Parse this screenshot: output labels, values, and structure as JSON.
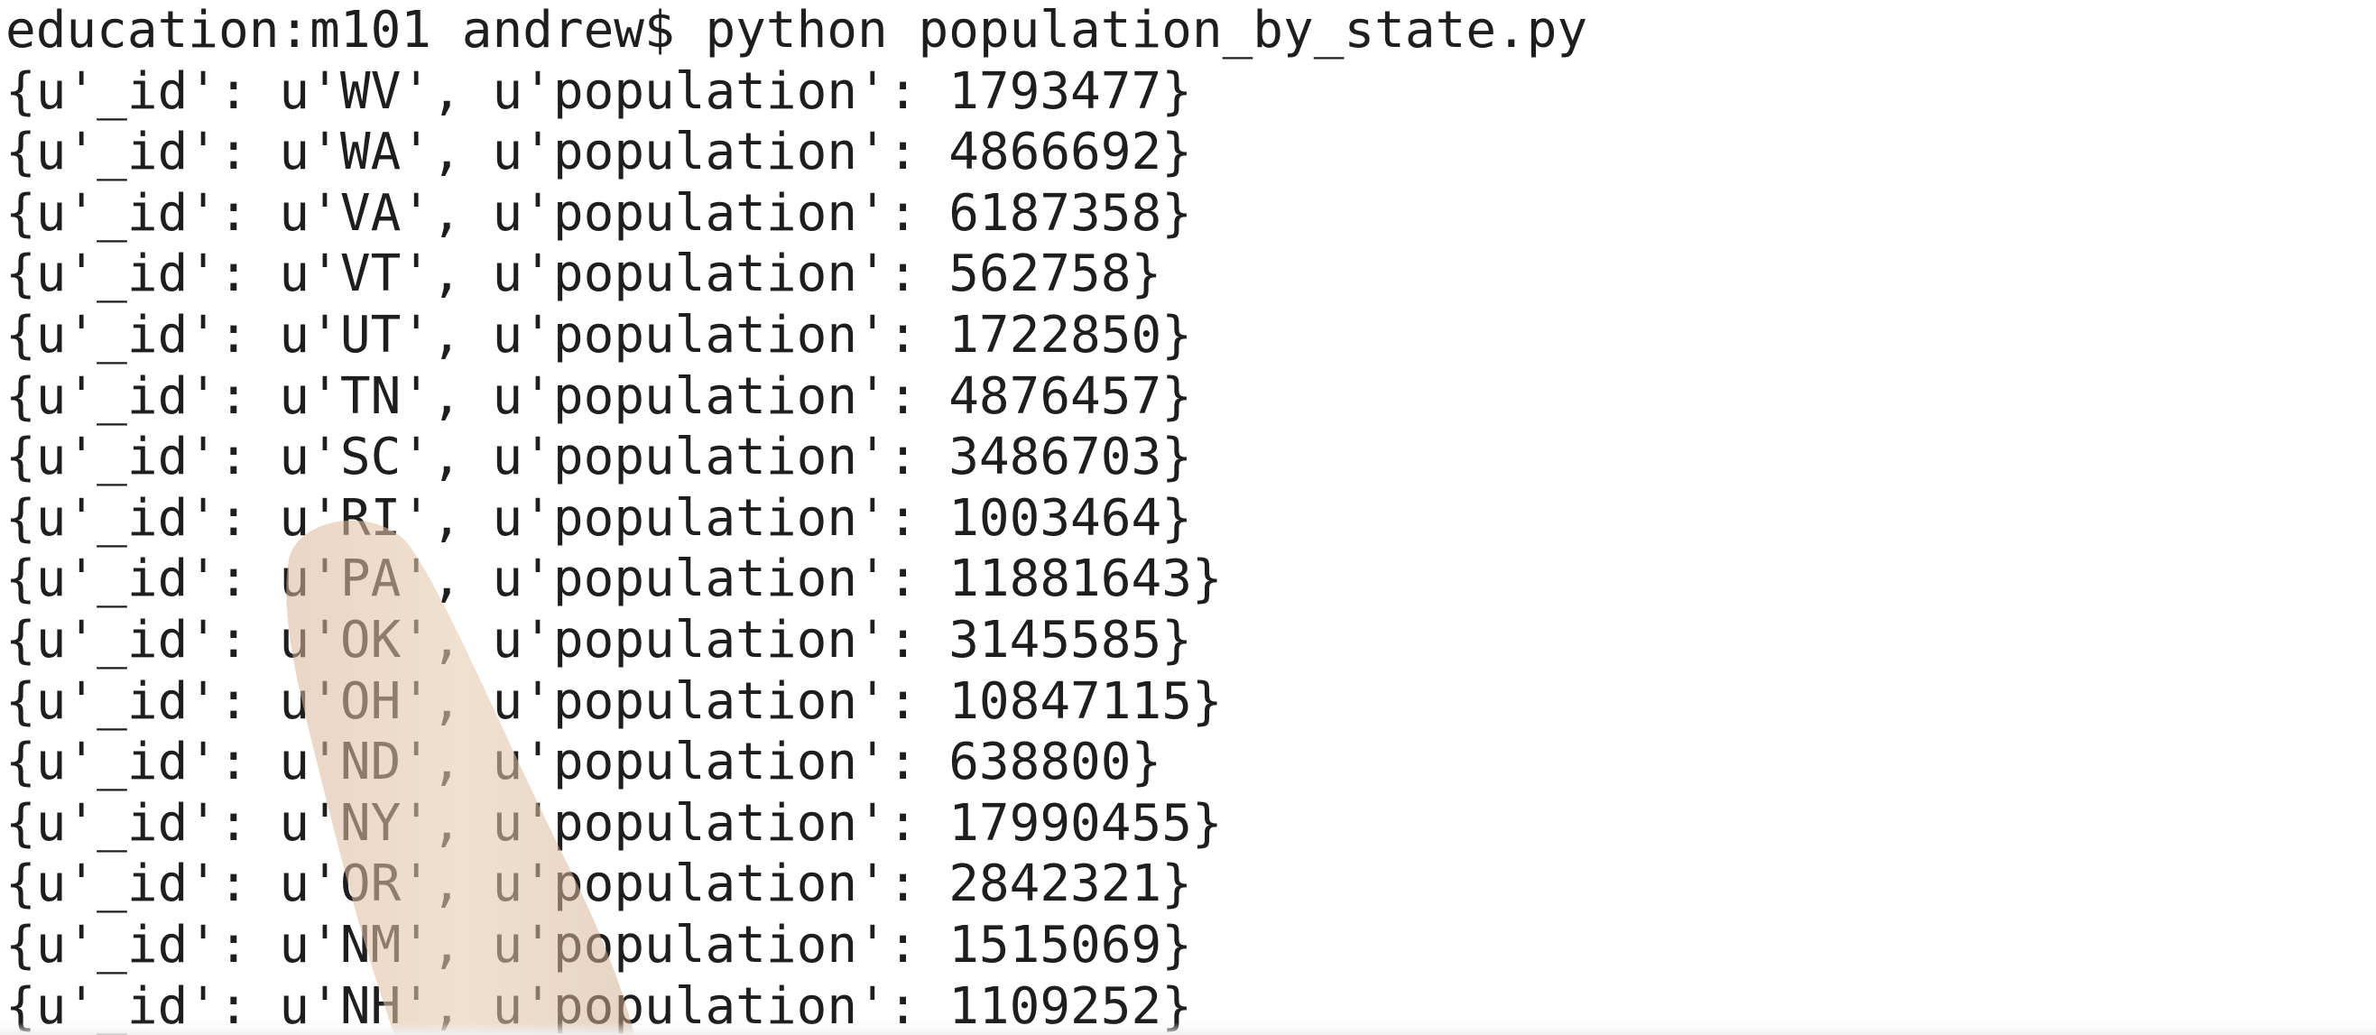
{
  "terminal": {
    "prompt_line": "education:m101 andrew$ python population_by_state.py",
    "records": [
      {
        "prefix": "{u'_id': u'",
        "state": "WV",
        "middle": "', u'population': ",
        "population": "1793477",
        "suffix": "}"
      },
      {
        "prefix": "{u'_id': u'",
        "state": "WA",
        "middle": "', u'population': ",
        "population": "4866692",
        "suffix": "}"
      },
      {
        "prefix": "{u'_id': u'",
        "state": "VA",
        "middle": "', u'population': ",
        "population": "6187358",
        "suffix": "}"
      },
      {
        "prefix": "{u'_id': u'",
        "state": "VT",
        "middle": "', u'population': ",
        "population": "562758",
        "suffix": "}"
      },
      {
        "prefix": "{u'_id': u'",
        "state": "UT",
        "middle": "', u'population': ",
        "population": "1722850",
        "suffix": "}"
      },
      {
        "prefix": "{u'_id': u'",
        "state": "TN",
        "middle": "', u'population': ",
        "population": "4876457",
        "suffix": "}"
      },
      {
        "prefix": "{u'_id': u'",
        "state": "SC",
        "middle": "', u'population': ",
        "population": "3486703",
        "suffix": "}"
      },
      {
        "prefix": "{u'_id': u'",
        "state": "RI",
        "middle": "', u'population': ",
        "population": "1003464",
        "suffix": "}"
      },
      {
        "prefix": "{u'_id': u'",
        "state": "PA",
        "middle": "', u'population': ",
        "population": "11881643",
        "suffix": "}"
      },
      {
        "prefix": "{u'_id': u'",
        "state": "OK",
        "middle": "', u'population': ",
        "population": "3145585",
        "suffix": "}"
      },
      {
        "prefix": "{u'_id': u'",
        "state": "OH",
        "middle": "', u'population': ",
        "population": "10847115",
        "suffix": "}"
      },
      {
        "prefix": "{u'_id': u'",
        "state": "ND",
        "middle": "', u'population': ",
        "population": "638800",
        "suffix": "}"
      },
      {
        "prefix": "{u'_id': u'",
        "state": "NY",
        "middle": "', u'population': ",
        "population": "17990455",
        "suffix": "}"
      },
      {
        "prefix": "{u'_id': u'",
        "state": "OR",
        "middle": "', u'population': ",
        "population": "2842321",
        "suffix": "}"
      },
      {
        "prefix": "{u'_id': u'",
        "state": "NM",
        "middle": "', u'population': ",
        "population": "1515069",
        "suffix": "}"
      },
      {
        "prefix": "{u'_id': u'",
        "state": "NH",
        "middle": "', u'population': ",
        "population": "1109252",
        "suffix": "}"
      }
    ]
  },
  "colors": {
    "background": "#ffffff",
    "text": "#1e1e1e",
    "finger": "#e2c4a6"
  },
  "overlay": {
    "finger_icon": "pointing-finger-icon"
  }
}
